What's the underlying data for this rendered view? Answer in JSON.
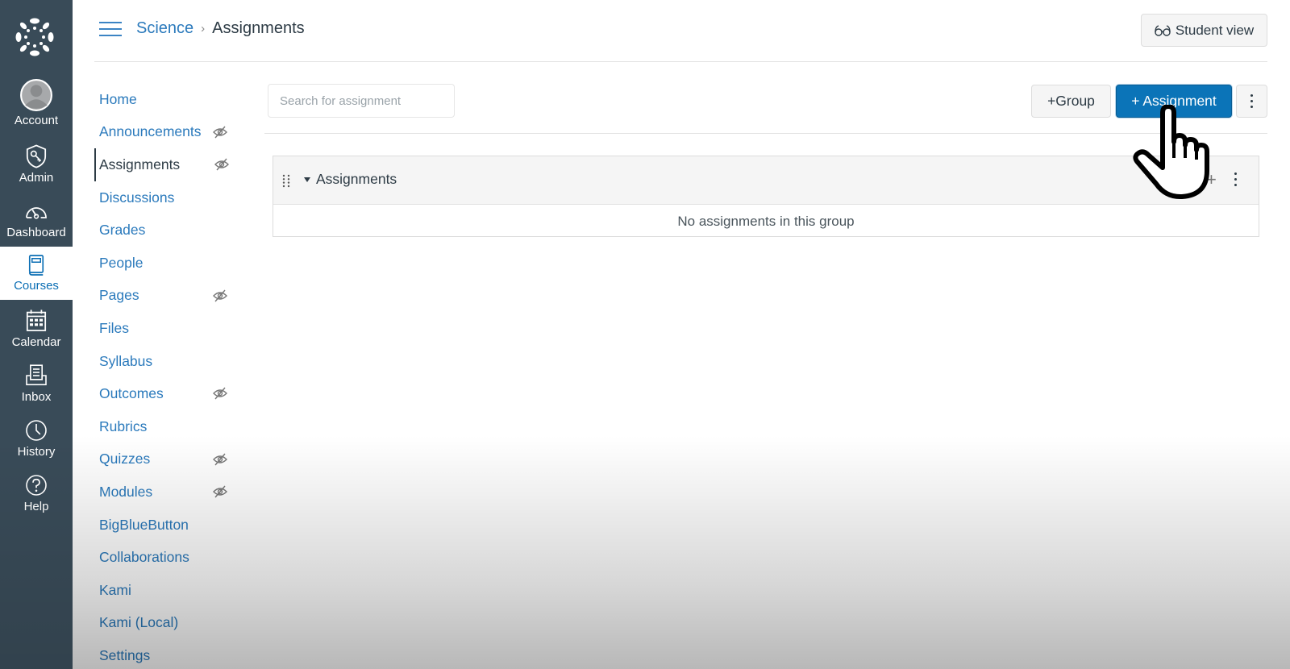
{
  "global_nav": {
    "items": [
      {
        "label": "Account",
        "icon": "avatar-icon"
      },
      {
        "label": "Admin",
        "icon": "shield-key-icon"
      },
      {
        "label": "Dashboard",
        "icon": "speedometer-icon"
      },
      {
        "label": "Courses",
        "icon": "book-icon",
        "active": true
      },
      {
        "label": "Calendar",
        "icon": "calendar-icon"
      },
      {
        "label": "Inbox",
        "icon": "inbox-icon"
      },
      {
        "label": "History",
        "icon": "clock-icon"
      },
      {
        "label": "Help",
        "icon": "question-circle-icon"
      }
    ]
  },
  "header": {
    "breadcrumb": [
      "Science",
      "Assignments"
    ],
    "breadcrumb_separator": "›",
    "student_view_label": "Student view"
  },
  "course_nav": {
    "items": [
      {
        "label": "Home",
        "hidden": false
      },
      {
        "label": "Announcements",
        "hidden": true
      },
      {
        "label": "Assignments",
        "hidden": true,
        "active": true
      },
      {
        "label": "Discussions",
        "hidden": false
      },
      {
        "label": "Grades",
        "hidden": false
      },
      {
        "label": "People",
        "hidden": false
      },
      {
        "label": "Pages",
        "hidden": true
      },
      {
        "label": "Files",
        "hidden": false
      },
      {
        "label": "Syllabus",
        "hidden": false
      },
      {
        "label": "Outcomes",
        "hidden": true
      },
      {
        "label": "Rubrics",
        "hidden": false
      },
      {
        "label": "Quizzes",
        "hidden": true
      },
      {
        "label": "Modules",
        "hidden": true
      },
      {
        "label": "BigBlueButton",
        "hidden": false
      },
      {
        "label": "Collaborations",
        "hidden": false
      },
      {
        "label": "Kami",
        "hidden": false
      },
      {
        "label": "Kami (Local)",
        "hidden": false
      },
      {
        "label": "Settings",
        "hidden": false
      }
    ]
  },
  "toolbar": {
    "search_placeholder": "Search for assignment",
    "search_value": "",
    "group_button_label": "+Group",
    "assignment_button_label": "+ Assignment",
    "more_button_icon": "kebab-icon"
  },
  "assignment_group": {
    "title": "Assignments",
    "add_label": "+",
    "empty_message": "No assignments in this group"
  },
  "colors": {
    "nav_background": "#394b58",
    "link": "#2b7abc",
    "primary_button": "#0b74b8",
    "active_nav_text": "#0b6eb4"
  }
}
